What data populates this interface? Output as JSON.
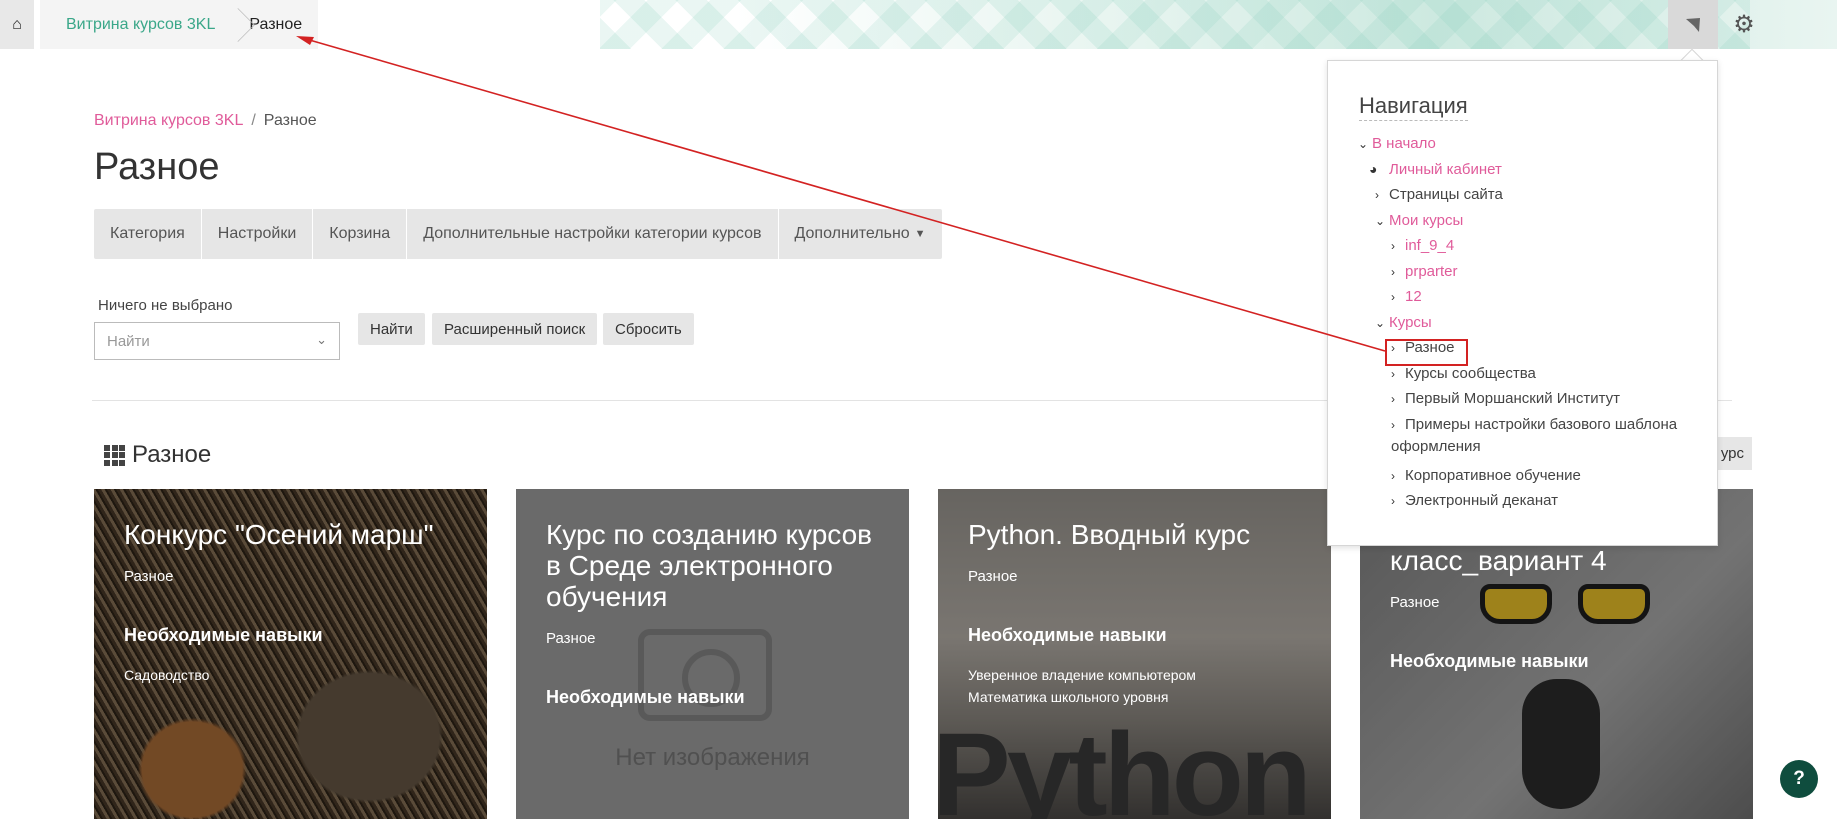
{
  "topbar": {
    "crumb_home": "Витрина курсов 3KL",
    "crumb_current": "Разное"
  },
  "page": {
    "breadcrumb_home": "Витрина курсов 3KL",
    "breadcrumb_sep": "/",
    "breadcrumb_current": "Разное",
    "title": "Разное"
  },
  "tabs": [
    {
      "label": "Категория"
    },
    {
      "label": "Настройки"
    },
    {
      "label": "Корзина"
    },
    {
      "label": "Дополнительные настройки категории курсов"
    },
    {
      "label": "Дополнительно"
    }
  ],
  "filter": {
    "label": "Ничего не выбрано",
    "placeholder": "Найти",
    "find_btn": "Найти",
    "advanced_btn": "Расширенный поиск",
    "reset_btn": "Сбросить"
  },
  "section": {
    "title": "Разное",
    "add_course_btn": "урс"
  },
  "cards": [
    {
      "title": "Конкурс \"Осений марш\"",
      "category": "Разное",
      "skills_heading": "Необходимые навыки",
      "skills": [
        "Садоводство"
      ]
    },
    {
      "title": "Курс по созданию курсов в Среде электронного обучения",
      "category": "Разное",
      "skills_heading": "Необходимые навыки",
      "no_image": "Нет изображения"
    },
    {
      "title": "Python. Вводный курс",
      "category": "Разное",
      "skills_heading": "Необходимые навыки",
      "skills": [
        "Уверенное владение компьютером",
        "Математика школьного уровня"
      ]
    },
    {
      "title": "класс_вариант 4",
      "category": "Разное",
      "skills_heading": "Необходимые навыки"
    }
  ],
  "navigation": {
    "title": "Навигация",
    "home": "В начало",
    "dashboard": "Личный кабинет",
    "site_pages": "Страницы сайта",
    "my_courses": "Мои курсы",
    "my_course_items": [
      "inf_9_4",
      "prparter",
      "12"
    ],
    "courses": "Курсы",
    "course_categories": [
      "Разное",
      "Курсы сообщества",
      "Первый Моршанский Институт",
      "Примеры настройки базового шаблона",
      "оформления",
      "Корпоративное обучение",
      "Электронный деканат"
    ]
  },
  "help": "?",
  "colors": {
    "accent_pink": "#e05b9a",
    "accent_teal": "#3aa789",
    "annotation_red": "#d32222",
    "help_bg": "#0f4d3e"
  }
}
